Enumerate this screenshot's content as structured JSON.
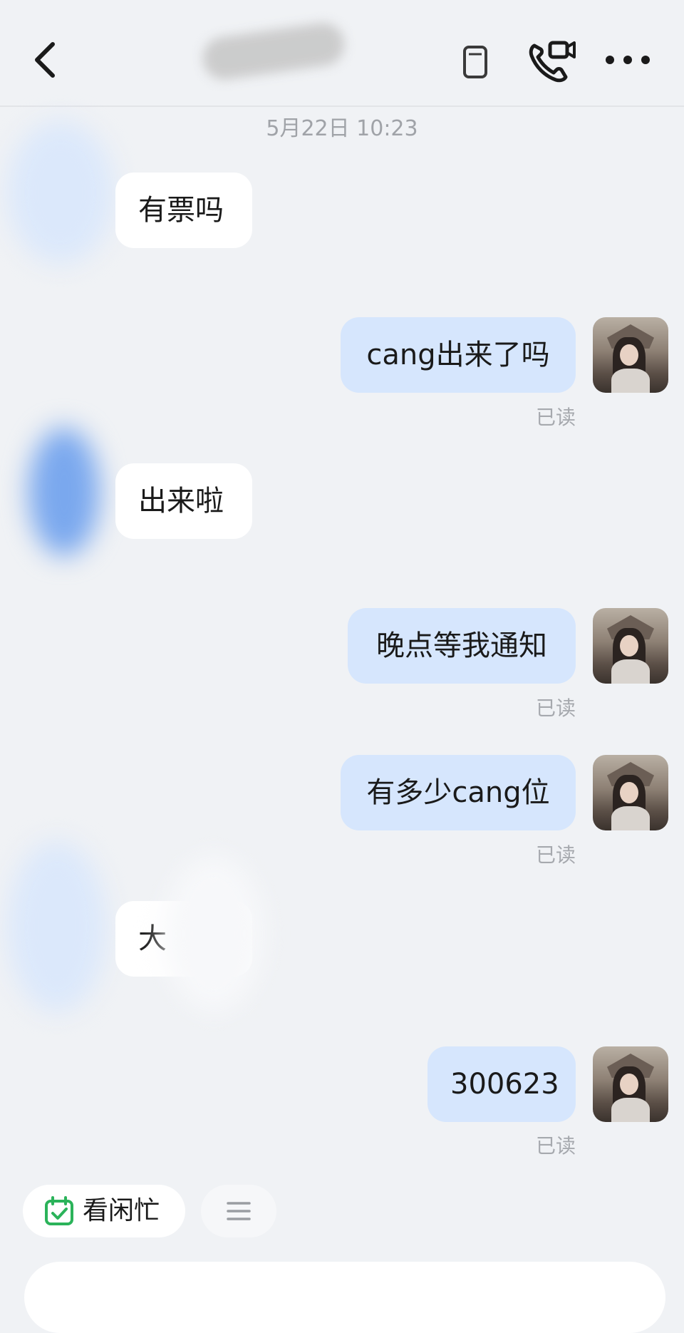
{
  "header": {
    "back_icon": "chevron-left-icon",
    "video_call_icon": "video-call-icon",
    "more_icon": "more-horizontal-icon"
  },
  "chat": {
    "timestamp": "5月22日 10:23",
    "messages": [
      {
        "side": "in",
        "text": "有票吗"
      },
      {
        "side": "out",
        "text": "cang出来了吗",
        "status": "已读"
      },
      {
        "side": "in",
        "text": "出来啦"
      },
      {
        "side": "out",
        "text": "晚点等我通知",
        "status": "已读"
      },
      {
        "side": "out",
        "text": "有多少cang位",
        "status": "已读"
      },
      {
        "side": "in",
        "text": "大"
      },
      {
        "side": "out",
        "text": "300623",
        "status": "已读"
      }
    ]
  },
  "quick_actions": {
    "busy_label": "看闲忙",
    "busy_icon": "calendar-check-icon",
    "menu_icon": "menu-lines-icon"
  },
  "colors": {
    "background": "#f0f2f5",
    "incoming_bubble": "#ffffff",
    "outgoing_bubble": "#d6e6fd",
    "read_status": "#a6a9ae",
    "calendar_green": "#2bb35a"
  }
}
